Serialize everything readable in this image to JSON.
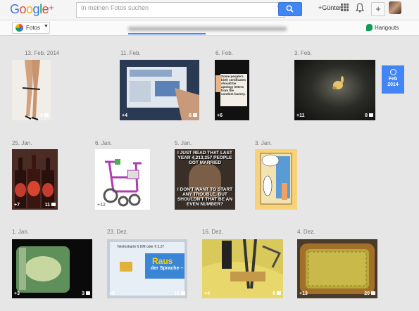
{
  "header": {
    "logo_text": "Google+",
    "search_placeholder": "In meinen Fotos suchen",
    "user_link": "+Günter",
    "share_label": "+"
  },
  "subnav": {
    "photos_label": "Fotos",
    "hangouts_label": "Hangouts"
  },
  "timeline_badge": {
    "month": "Feb",
    "year": "2014"
  },
  "rows": [
    {
      "dates": [
        "13. Feb. 2014",
        "11. Feb.",
        "6. Feb.",
        "3. Feb."
      ],
      "counts": [
        "",
        "+4",
        "+6",
        "+11"
      ],
      "comments": [
        "9",
        "6",
        "",
        "8"
      ]
    },
    {
      "dates": [
        "25. Jan.",
        "6. Jan.",
        "5. Jan.",
        "3. Jan."
      ],
      "counts": [
        "+7",
        "+12",
        "",
        ""
      ],
      "comments": [
        "11",
        "",
        "",
        ""
      ]
    },
    {
      "dates": [
        "1. Jan.",
        "23. Dez.",
        "16. Dez.",
        "4. Dez."
      ],
      "counts": [
        "+3",
        "+8",
        "+4",
        "+13"
      ],
      "comments": [
        "3",
        "15",
        "6",
        "20"
      ]
    }
  ],
  "meme": {
    "top": "I JUST READ THAT LAST YEAR 4,213,257 PEOPLE GOT MARRIED",
    "bottom": "I DON'T WANT TO START ANY TROUBLE, BUT SHOULDN'T THAT BE AN EVEN NUMBER?"
  },
  "sign_text": "Some people's birth certificates should be apology letters from the condom factory.",
  "phonecard": {
    "top": "Telefonkarte 6 DM oder € 3,07",
    "mid1": "Raus",
    "mid2": "der Sprache –"
  },
  "colors": {
    "accent": "#4285f4",
    "hangouts": "#0f9d58"
  }
}
